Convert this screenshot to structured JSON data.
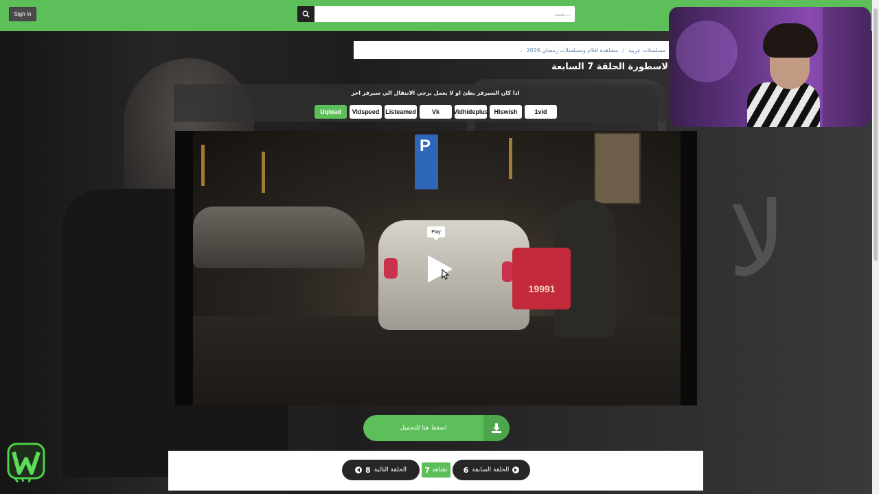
{
  "header": {
    "signin_label": "Sign In",
    "search_placeholder": "بحث..."
  },
  "breadcrumb": {
    "items": [
      "مسلسلات عربية",
      "مشاهدة افلام ومسلسلات رمضان 2026",
      "،"
    ]
  },
  "page_title": "لاسطورة الحلقة 7 السابعة",
  "servers": {
    "note": "اذا كان السيرفر بطئ او لا يعمل برجي الانتقال الي سيرفر اخر",
    "items": [
      {
        "label": "Uqload",
        "active": true
      },
      {
        "label": "Vidspeed",
        "active": false
      },
      {
        "label": "Listeamed",
        "active": false
      },
      {
        "label": "Vk",
        "active": false
      },
      {
        "label": "Vidhideplus",
        "active": false
      },
      {
        "label": "Hlswish",
        "active": false
      },
      {
        "label": "1vid",
        "active": false
      }
    ]
  },
  "player": {
    "tooltip": "Play",
    "scene_text": "19991",
    "sign_letter": "P"
  },
  "download": {
    "label": "اضغط هنا للتحميل"
  },
  "episode_nav": {
    "prev_label": "الحلقة السابقة",
    "prev_number": "6",
    "current_label": "تشاهد",
    "current_number": "7",
    "next_label": "الحلقة التالية",
    "next_number": "8"
  },
  "colors": {
    "accent": "#5cbf5a",
    "dark_button": "#262626"
  }
}
